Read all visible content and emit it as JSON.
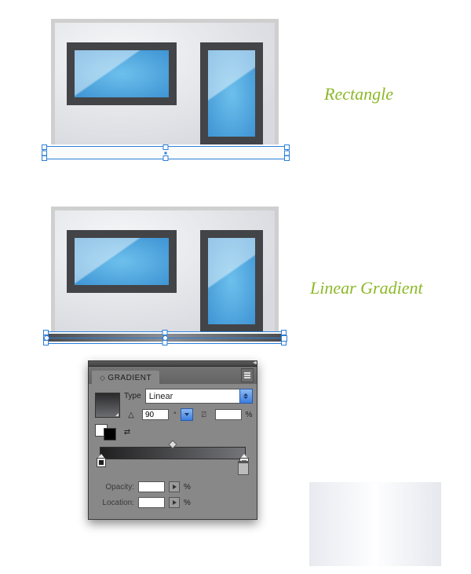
{
  "labels": {
    "rectangle": "Rectangle",
    "linear_gradient": "Linear Gradient"
  },
  "panel": {
    "title": "GRADIENT",
    "type_label": "Type",
    "type_value": "Linear",
    "angle_value": "90",
    "ratio_value": "",
    "ratio_pct": "%",
    "opacity_label": "Opacity:",
    "opacity_value": "",
    "opacity_pct": "%",
    "location_label": "Location:",
    "location_value": "",
    "location_pct": "%"
  }
}
